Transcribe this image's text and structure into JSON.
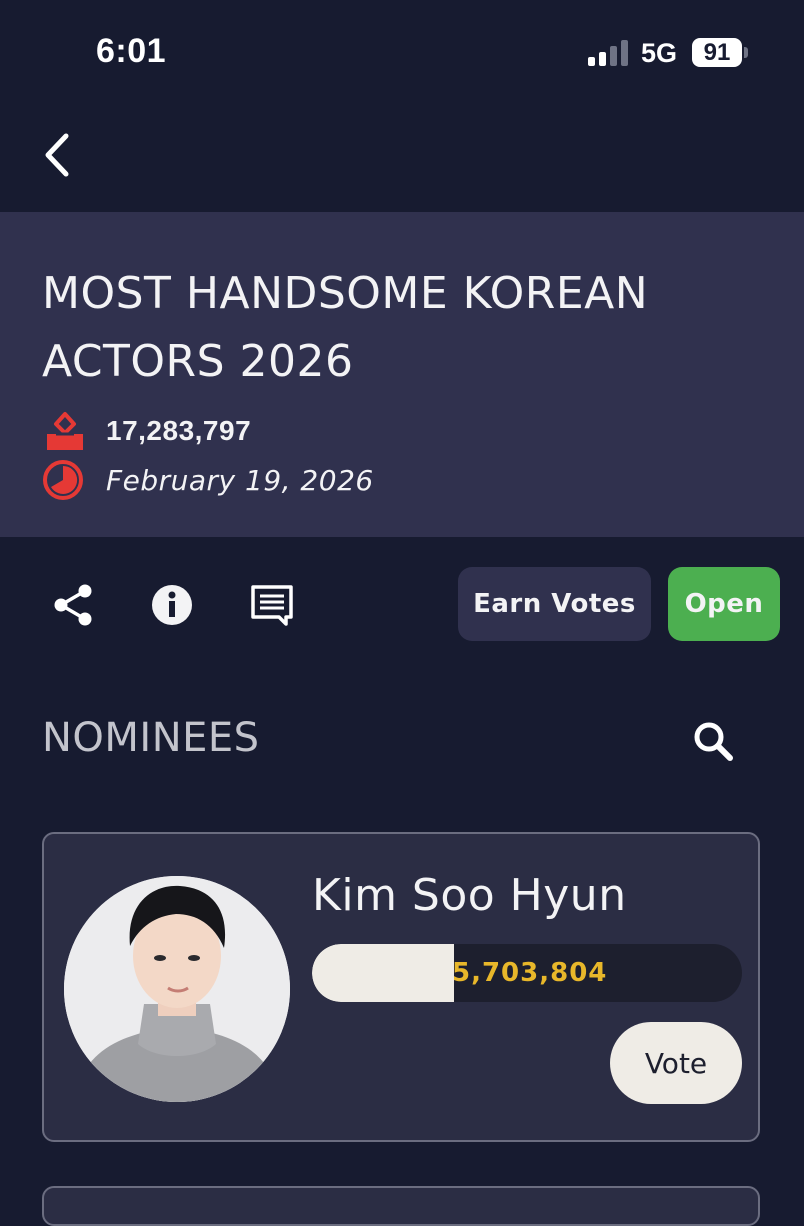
{
  "status_bar": {
    "time": "6:01",
    "network": "5G",
    "battery": "91"
  },
  "poll": {
    "title": "MOST HANDSOME KOREAN ACTORS 2026",
    "total_votes": "17,283,797",
    "end_date": "February 19, 2026"
  },
  "actions": {
    "earn_votes_label": "Earn Votes",
    "status_label": "Open"
  },
  "nominees_section": {
    "heading": "NOMINEES",
    "items": [
      {
        "name": "Kim Soo Hyun",
        "votes": "5,703,804",
        "vote_label": "Vote",
        "bar_fill_fraction": 0.33
      }
    ]
  },
  "colors": {
    "background": "#171b30",
    "header_panel": "#30314e",
    "accent_red": "#e53935",
    "open_green": "#4caf50",
    "vote_count_gold": "#e8b72a"
  }
}
